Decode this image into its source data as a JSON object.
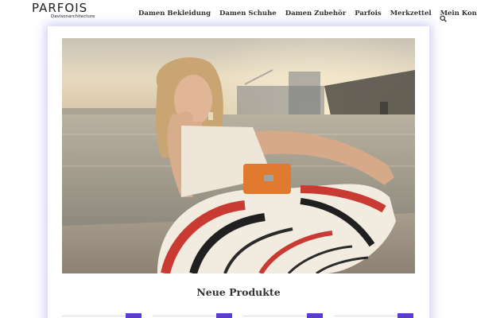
{
  "brand": {
    "logo_text": "PARFOIS",
    "logo_subtitle": "Davisonarchitecture"
  },
  "nav": {
    "items": [
      {
        "label": "Damen Bekleidung"
      },
      {
        "label": "Damen Schuhe"
      },
      {
        "label": "Damen Zubehör"
      },
      {
        "label": "Parfois"
      },
      {
        "label": "Merkzettel"
      },
      {
        "label": "Mein Konto"
      }
    ],
    "search_icon": "search-icon"
  },
  "hero": {
    "slider_prev_icon": "‹",
    "image_alt": "woman-with-orange-bag-photo"
  },
  "sections": {
    "new_products_title": "Neue Produkte"
  },
  "colors": {
    "accent": "#5b3bd6",
    "panel_glow": "#6e6edc",
    "text": "#333333"
  },
  "product_cards_count": 4
}
